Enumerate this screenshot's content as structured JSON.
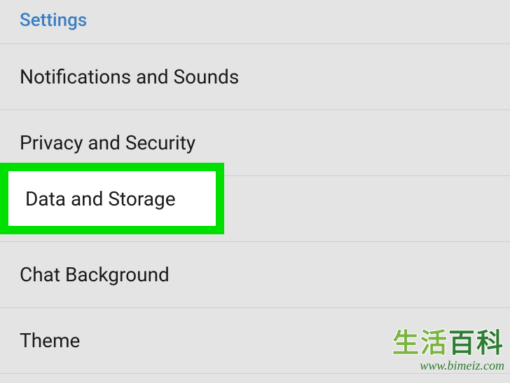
{
  "header": {
    "title": "Settings"
  },
  "items": [
    {
      "label": "Notifications and Sounds",
      "value": ""
    },
    {
      "label": "Privacy and Security",
      "value": ""
    },
    {
      "label": "Data and Storage",
      "value": ""
    },
    {
      "label": "Chat Background",
      "value": ""
    },
    {
      "label": "Theme",
      "value": ""
    }
  ],
  "highlight": {
    "label": "Data and Storage"
  },
  "watermark": {
    "main_left": "生活",
    "main_right": "百科",
    "url": "www.bimeiz.com"
  }
}
